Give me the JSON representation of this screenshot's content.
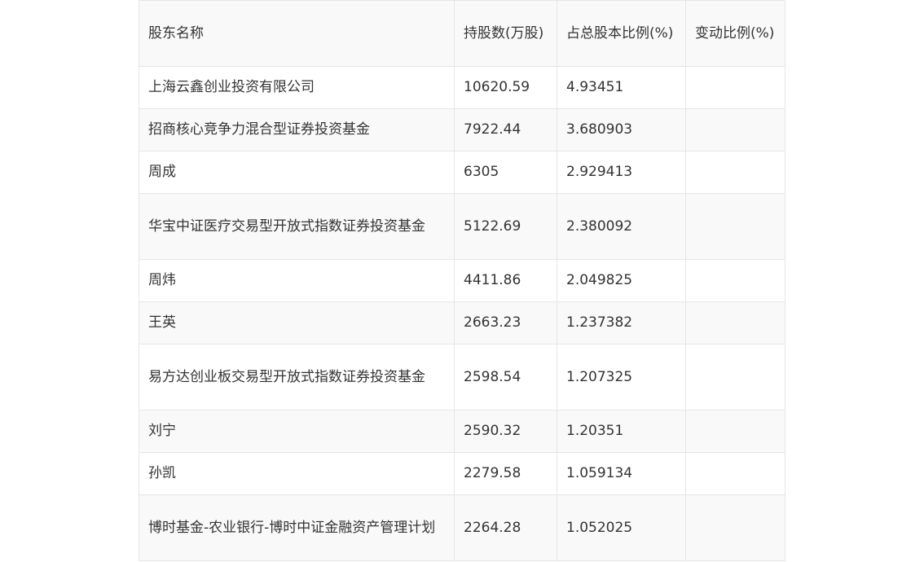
{
  "headers": [
    "股东名称",
    "持股数(万股)",
    "占总股本比例(%)",
    "变动比例(%)"
  ],
  "rows": [
    {
      "name": "上海云鑫创业投资有限公司",
      "shares": "10620.59",
      "ratio": "4.93451",
      "change": ""
    },
    {
      "name": "招商核心竞争力混合型证券投资基金",
      "shares": "7922.44",
      "ratio": "3.680903",
      "change": ""
    },
    {
      "name": "周成",
      "shares": "6305",
      "ratio": "2.929413",
      "change": ""
    },
    {
      "name": "华宝中证医疗交易型开放式指数证券投资基金",
      "shares": "5122.69",
      "ratio": "2.380092",
      "change": ""
    },
    {
      "name": "周炜",
      "shares": "4411.86",
      "ratio": "2.049825",
      "change": ""
    },
    {
      "name": "王英",
      "shares": "2663.23",
      "ratio": "1.237382",
      "change": ""
    },
    {
      "name": "易方达创业板交易型开放式指数证券投资基金",
      "shares": "2598.54",
      "ratio": "1.207325",
      "change": ""
    },
    {
      "name": "刘宁",
      "shares": "2590.32",
      "ratio": "1.20351",
      "change": ""
    },
    {
      "name": "孙凯",
      "shares": "2279.58",
      "ratio": "1.059134",
      "change": ""
    },
    {
      "name": "博时基金-农业银行-博时中证金融资产管理计划",
      "shares": "2264.28",
      "ratio": "1.052025",
      "change": ""
    }
  ]
}
